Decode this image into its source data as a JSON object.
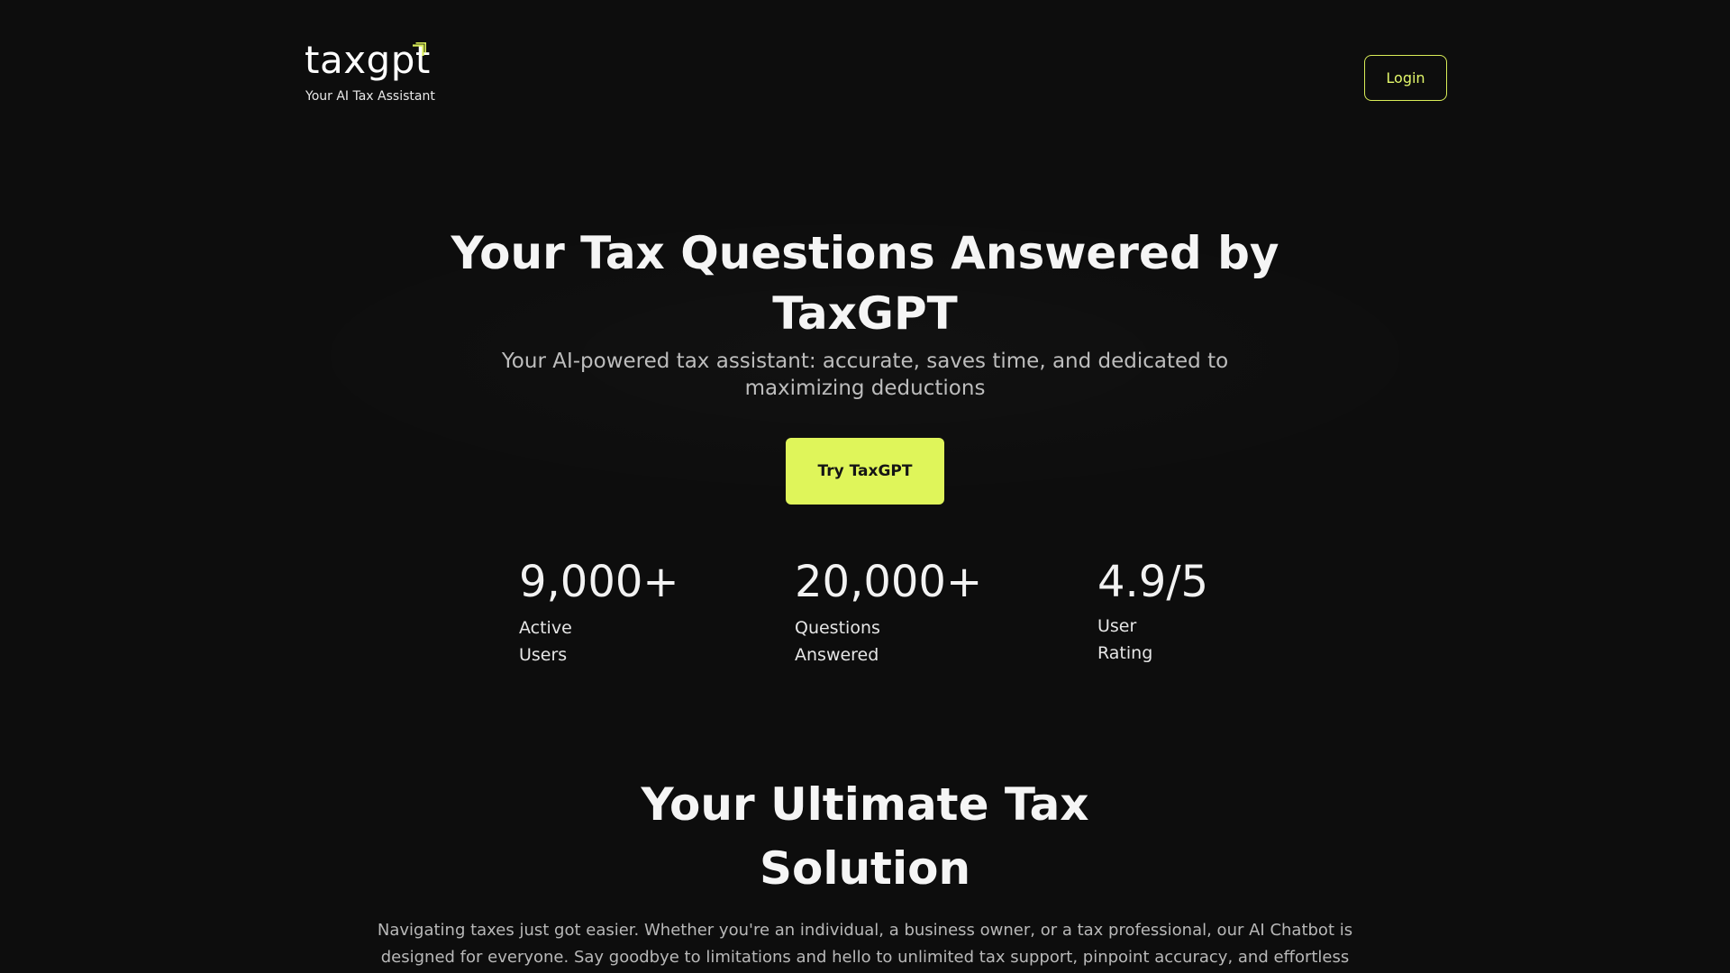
{
  "header": {
    "logo_text": "taxgpt",
    "tagline": "Your AI Tax Assistant",
    "login_label": "Login"
  },
  "hero": {
    "title_line1": "Your Tax Questions Answered by",
    "title_line2": "TaxGPT",
    "subtitle_line1": "Your AI-powered tax assistant: accurate, saves time, and dedicated to",
    "subtitle_line2": "maximizing deductions",
    "cta_label": "Try TaxGPT"
  },
  "stats": [
    {
      "value": "9,000+",
      "label_line1": "Active",
      "label_line2": "Users"
    },
    {
      "value": "20,000+",
      "label_line1": "Questions",
      "label_line2": "Answered"
    },
    {
      "value": "4.9/5",
      "label_line1": "User",
      "label_line2": "Rating"
    }
  ],
  "section": {
    "title_line1": "Your Ultimate Tax",
    "title_line2": "Solution",
    "body_line1": "Navigating taxes just got easier. Whether you're an individual, a business owner, or a tax professional, our AI Chatbot is",
    "body_line2": "designed for everyone. Say goodbye to limitations and hello to unlimited tax support, pinpoint accuracy, and effortless filing."
  },
  "colors": {
    "background": "#0d0d0d",
    "accent": "#dff55a",
    "text": "#f2f2f2",
    "muted_text": "#bdbdbd"
  },
  "icons": {
    "logo_mark": "corner-arrow-icon"
  }
}
